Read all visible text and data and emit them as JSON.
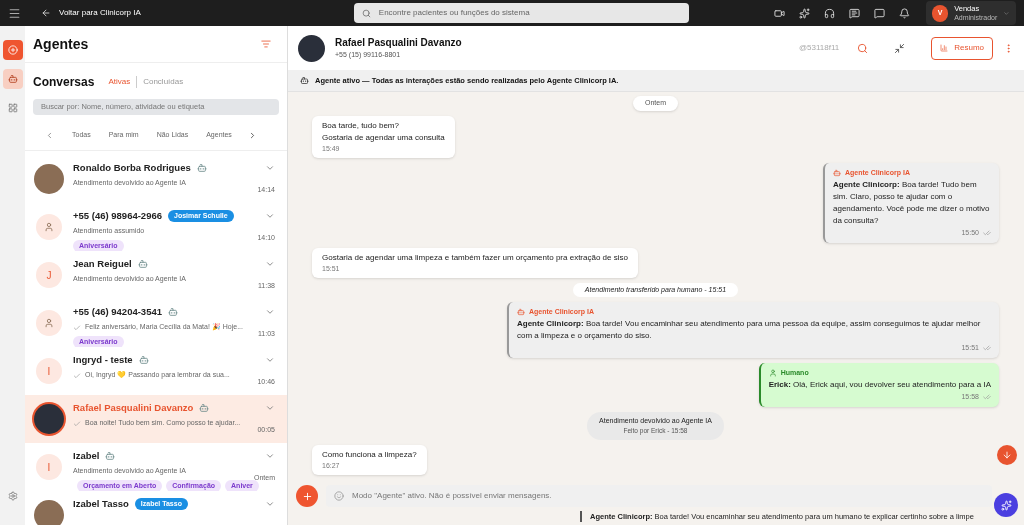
{
  "topbar": {
    "back": "Voltar para Clinicorp IA",
    "search_placeholder": "Encontre pacientes ou funções do sistema",
    "user": {
      "initial": "V",
      "name": "Vendas",
      "role": "Administrador"
    }
  },
  "sidebar": {
    "items": [
      {
        "kind": "add",
        "selected": false
      },
      {
        "kind": "bot",
        "selected": true
      },
      {
        "kind": "grid",
        "selected": false
      }
    ]
  },
  "list": {
    "title": "Agentes",
    "section": "Conversas",
    "status_tabs": [
      {
        "label": "Ativas",
        "selected": true
      },
      {
        "label": "Concluídas",
        "selected": false
      }
    ],
    "search_placeholder": "Buscar por: Nome, número, atividade ou etiqueta",
    "filters": [
      {
        "label": "Todas",
        "selected": false
      },
      {
        "label": "Para mim",
        "selected": false
      },
      {
        "label": "Não Lidas",
        "selected": false
      },
      {
        "label": "Agentes",
        "selected": false
      }
    ],
    "conversations": [
      {
        "name": "Ronaldo Borba Rodrigues",
        "kind": "photo",
        "bot": true,
        "preview": "Atendimento devolvido ao Agente IA",
        "read": false,
        "time": "14:14",
        "selected": false
      },
      {
        "name": "+55 (46) 98964-2966",
        "kind": "person",
        "bot": false,
        "assignee": "Josimar Schulle",
        "preview": "Atendimento assumido",
        "read": false,
        "tags": [
          "Aniversário"
        ],
        "time": "14:10",
        "selected": false
      },
      {
        "name": "Jean Reiguel",
        "kind": "initial",
        "initial": "J",
        "bot": true,
        "preview": "Atendimento devolvido ao Agente IA",
        "read": false,
        "time": "11:38",
        "selected": false
      },
      {
        "name": "+55 (46) 94204-3541",
        "kind": "person",
        "bot": true,
        "preview": "Feliz aniversário, Maria Cecília da Mata! 🎉 Hoje...",
        "read": true,
        "tags": [
          "Aniversário"
        ],
        "time": "11:03",
        "selected": false
      },
      {
        "name": "Ingryd - teste",
        "kind": "initial",
        "initial": "I",
        "bot": true,
        "preview": "Oi, Ingryd 💛 Passando para lembrar da sua...",
        "read": true,
        "time": "10:46",
        "selected": false
      },
      {
        "name": "Rafael Pasqualini Davanzo",
        "kind": "photo",
        "bot": true,
        "preview": "Boa noite! Tudo bem sim. Como posso te ajudar...",
        "read": true,
        "time": "00:05",
        "selected": true
      },
      {
        "name": "Izabel",
        "kind": "initial",
        "initial": "I",
        "bot": true,
        "preview": "Atendimento devolvido ao Agente IA",
        "read": false,
        "tags": [
          "Orçamento em Aberto",
          "Confirmação",
          "Aniver"
        ],
        "time": "Ontem",
        "selected": false
      },
      {
        "name": "Izabel Tasso",
        "kind": "photo",
        "bot": false,
        "assignee": "Izabel Tasso",
        "read": false,
        "selected": false
      }
    ]
  },
  "chat": {
    "name": "Rafael Pasqualini Davanzo",
    "phone": "+55 (15) 99116-8801",
    "handle": "@53118f11",
    "summary_button": "Resumo",
    "banner": "Agente ativo — Todas as interações estão sendo realizadas pelo Agente Clinicorp IA.",
    "messages": [
      {
        "kind": "date",
        "text": "Ontem"
      },
      {
        "kind": "incoming",
        "lines": [
          "Boa tarde, tudo bem?",
          "Gostaria de agendar uma consulta"
        ],
        "time": "15:49"
      },
      {
        "kind": "agent",
        "label": "Agente Clinicorp IA",
        "text": "**Agente Clinicorp:** Boa tarde! Tudo bem sim. Claro, posso te ajudar com o agendamento. Você pode me dizer o motivo da consulta?",
        "time": "15:50",
        "narrow": true
      },
      {
        "kind": "incoming",
        "lines": [
          "Gostaria de agendar uma limpeza e também fazer um orçamento pra extração de siso"
        ],
        "time": "15:51"
      },
      {
        "kind": "event",
        "text": "Atendimento transferido para humano - 15:51"
      },
      {
        "kind": "agent",
        "label": "Agente Clinicorp IA",
        "text": "**Agente Clinicorp:** Boa tarde! Vou encaminhar seu atendimento para uma pessoa da equipe, assim conseguimos te ajudar melhor com a limpeza e o orçamento do siso.",
        "time": "15:51",
        "narrow": false
      },
      {
        "kind": "human",
        "label": "Humano",
        "text": "**Erick:** Olá, Erick aqui, vou devolver seu atendimento para a IA",
        "time": "15:58"
      },
      {
        "kind": "system",
        "text": "Atendimento devolvido ao Agente IA",
        "sub": "Feito por Erick - 15:58"
      },
      {
        "kind": "incoming",
        "lines": [
          "Como funciona a limpeza?"
        ],
        "time": "16:27"
      }
    ],
    "composer_placeholder": "Modo \"Agente\" ativo. Não é possível enviar mensagens.",
    "suggestion": "**Agente Clinicorp:** Boa tarde! Vou encaminhar seu atendimento para um humano te explicar certinho sobre a limpe"
  }
}
